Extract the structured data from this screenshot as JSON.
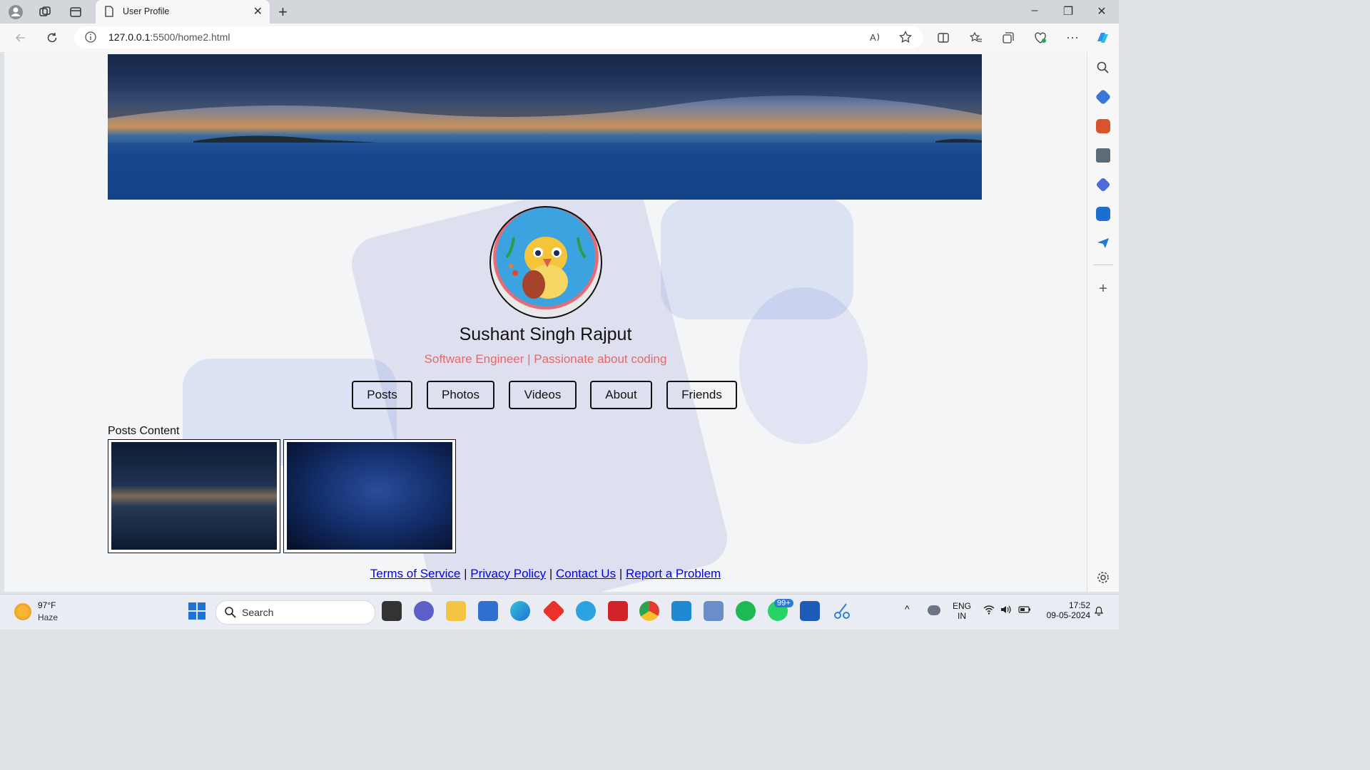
{
  "browser": {
    "tab_title": "User Profile",
    "url_host": "127.0.0.1",
    "url_rest": ":5500/home2.html"
  },
  "profile": {
    "name": "Sushant Singh Rajput",
    "tagline": "Software Engineer | Passionate about coding",
    "tabs": [
      "Posts",
      "Photos",
      "Videos",
      "About",
      "Friends"
    ],
    "posts_title": "Posts Content"
  },
  "footer": {
    "links": [
      "Terms of Service",
      "Privacy Policy",
      "Contact Us",
      "Report a Problem"
    ],
    "separator": "|"
  },
  "taskbar": {
    "temperature": "97°F",
    "condition": "Haze",
    "search_placeholder": "Search",
    "lang_line1": "ENG",
    "lang_line2": "IN",
    "time": "17:52",
    "date": "09-05-2024",
    "whatsapp_badge": "99+"
  }
}
